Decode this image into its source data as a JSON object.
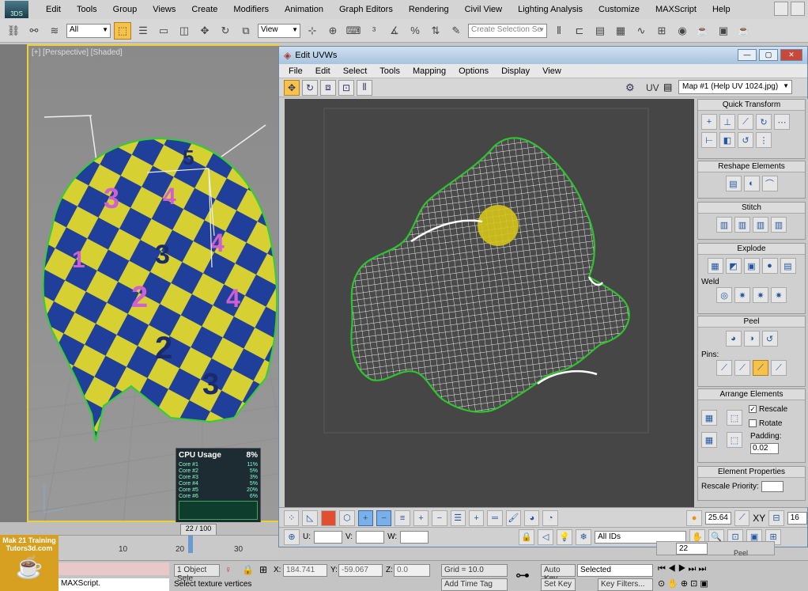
{
  "app": {
    "logo_text": "3DS",
    "menu": [
      "Edit",
      "Tools",
      "Group",
      "Views",
      "Create",
      "Modifiers",
      "Animation",
      "Graph Editors",
      "Rendering",
      "Civil View",
      "Lighting Analysis",
      "Customize",
      "MAXScript",
      "Help"
    ]
  },
  "toolbar": {
    "filter_value": "All",
    "refcoord_value": "View",
    "selection_set_placeholder": "Create Selection Se"
  },
  "viewport": {
    "label": "[+] [Perspective] [Shaded]"
  },
  "cpu_widget": {
    "title": "CPU Usage",
    "total": "8%",
    "cores": [
      {
        "name": "Core #1",
        "value": "11%"
      },
      {
        "name": "Core #2",
        "value": "5%"
      },
      {
        "name": "Core #3",
        "value": "3%"
      },
      {
        "name": "Core #4",
        "value": "5%"
      },
      {
        "name": "Core #5",
        "value": "20%"
      },
      {
        "name": "Core #6",
        "value": "6%"
      }
    ]
  },
  "timeline": {
    "frame_display": "22 / 100",
    "ticks": [
      "0",
      "10",
      "20",
      "30"
    ]
  },
  "uvw": {
    "title": "Edit UVWs",
    "menu": [
      "File",
      "Edit",
      "Select",
      "Tools",
      "Mapping",
      "Options",
      "Display",
      "View"
    ],
    "uv_label": "UV",
    "map_value": "Map #1 (Help UV 1024.jpg)",
    "panel": {
      "quick_transform": "Quick Transform",
      "reshape": "Reshape Elements",
      "stitch": "Stitch",
      "explode": "Explode",
      "weld": "Weld",
      "peel": "Peel",
      "pins": "Pins:",
      "arrange": "Arrange Elements",
      "rescale": "Rescale",
      "rotate": "Rotate",
      "padding_label": "Padding:",
      "padding_value": "0.02",
      "element_props": "Element Properties",
      "rescale_priority": "Rescale Priority:",
      "peel_tab": "Peel"
    },
    "bottom": {
      "soft_value": "25.64",
      "xy_label": "XY",
      "grid_value": "16",
      "u_label": "U:",
      "v_label": "V:",
      "w_label": "W:",
      "ids_value": "All IDs",
      "zoom_value": "22"
    }
  },
  "status": {
    "maxscript_label": "MAXScript.",
    "selected_label": "1 Object Sele",
    "prompt": "Select texture vertices",
    "x_label": "X:",
    "x_value": "184.741",
    "y_label": "Y:",
    "y_value": "-59.067",
    "z_label": "Z:",
    "z_value": "0.0",
    "grid": "Grid = 10.0",
    "add_time_tag": "Add Time Tag",
    "auto_key": "Auto Key",
    "set_key": "Set Key",
    "key_mode_value": "Selected",
    "key_filters": "Key Filters..."
  },
  "branding": {
    "line1": "Mak 21 Training",
    "line2": "Tutors3d.com"
  }
}
